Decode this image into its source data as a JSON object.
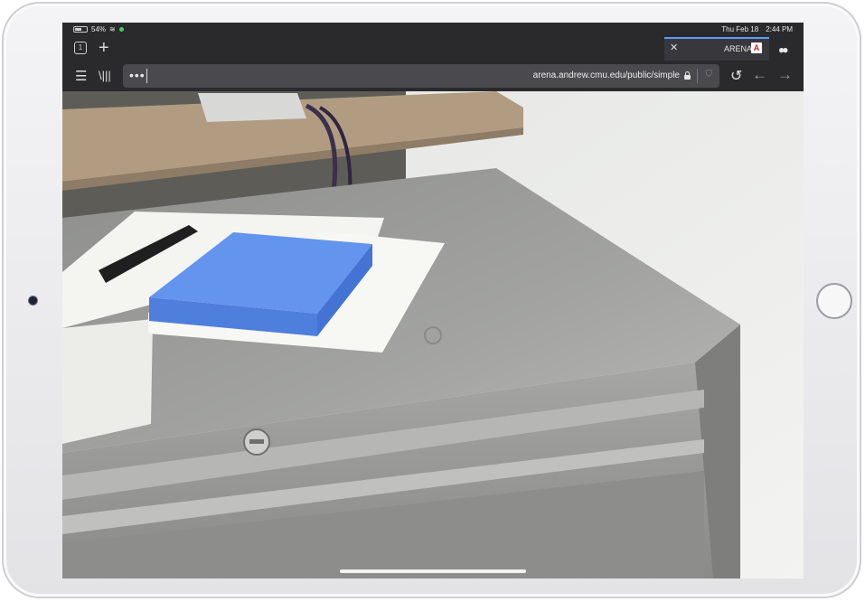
{
  "status_bar": {
    "time": "2:44 PM",
    "date": "Thu Feb 18",
    "battery": "54%",
    "wifi_icon": "wifi-icon"
  },
  "tabs": {
    "count": "1",
    "new_tab_icon": "plus-icon",
    "active_tab": {
      "title": "ARENA",
      "close_icon": "close-icon"
    }
  },
  "nav": {
    "url": "arena.andrew.cmu.edu/public/simple",
    "more_label": "•••",
    "menu_icon": "hamburger-icon",
    "library_icon": "library-icon"
  },
  "scene": {
    "object": "blue-box",
    "object_color": "#5b8ee6"
  },
  "colors": {
    "chrome": "#2a2a2d",
    "url_bar": "#4a4a4e",
    "progress": "#5b9df9"
  }
}
